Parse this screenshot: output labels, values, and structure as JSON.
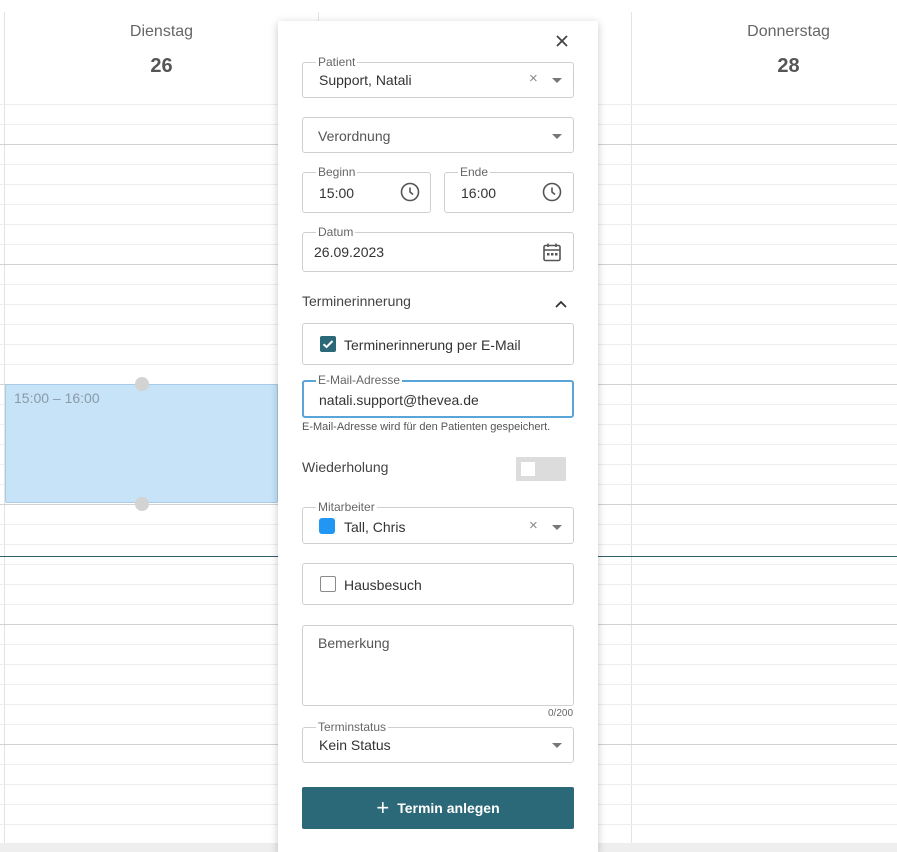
{
  "calendar": {
    "days": [
      {
        "name": "Dienstag",
        "number": "26"
      },
      {
        "name": "",
        "number": ""
      },
      {
        "name": "Donnerstag",
        "number": "28"
      }
    ],
    "event": {
      "time": "15:00 – 16:00",
      "color": "#c7e3f8"
    }
  },
  "dialog": {
    "close_icon": "close-icon",
    "patient": {
      "label": "Patient",
      "value": "Support, Natali",
      "clear": "×"
    },
    "verordnung": {
      "placeholder": "Verordnung"
    },
    "beginn": {
      "label": "Beginn",
      "value": "15:00",
      "icon": "clock-icon"
    },
    "ende": {
      "label": "Ende",
      "value": "16:00",
      "icon": "clock-icon"
    },
    "datum": {
      "label": "Datum",
      "value": "26.09.2023",
      "icon": "calendar-icon"
    },
    "reminder_section": {
      "title": "Terminerinnerung",
      "expanded": true
    },
    "reminder_email": {
      "label": "Terminerinnerung per E-Mail",
      "checked": true
    },
    "email": {
      "label": "E-Mail-Adresse",
      "value": "natali.support@thevea.de",
      "hint": "E-Mail-Adresse wird für den Patienten gespeichert."
    },
    "wiederholung": {
      "label": "Wiederholung",
      "on": false
    },
    "mitarbeiter": {
      "label": "Mitarbeiter",
      "value": "Tall, Chris",
      "color": "#2196f3",
      "clear": "×"
    },
    "hausbesuch": {
      "label": "Hausbesuch",
      "checked": false
    },
    "bemerkung": {
      "placeholder": "Bemerkung",
      "counter": "0/200"
    },
    "terminstatus": {
      "label": "Terminstatus",
      "value": "Kein Status"
    },
    "submit": {
      "icon": "plus-icon",
      "label": "Termin anlegen"
    },
    "colors": {
      "primary": "#2b6878",
      "focus": "#5aa5d8"
    }
  }
}
